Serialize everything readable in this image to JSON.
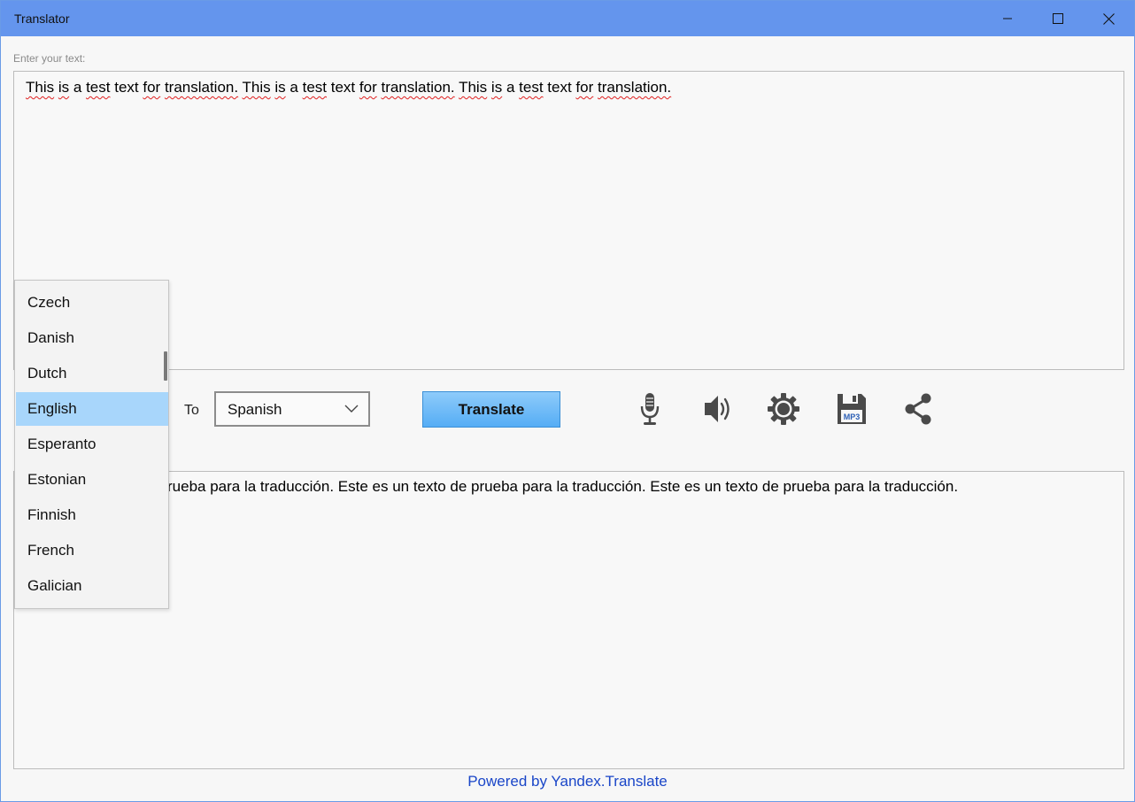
{
  "window": {
    "title": "Translator"
  },
  "input": {
    "label": "Enter your text:",
    "text_words": [
      "This",
      " ",
      "is",
      " ",
      "a",
      " ",
      "test",
      " ",
      "text",
      " ",
      "for",
      " ",
      "translation.",
      " ",
      "This",
      " ",
      "is",
      " ",
      "a",
      " ",
      "test",
      " ",
      "text",
      " ",
      "for",
      " ",
      "translation.",
      " ",
      "This",
      " ",
      "is",
      " ",
      "a",
      " ",
      "test",
      " ",
      "text",
      " ",
      "for",
      " ",
      "translation."
    ]
  },
  "controls": {
    "to_label": "To",
    "target_language": "Spanish",
    "translate_label": "Translate",
    "save_badge": "MP3"
  },
  "output": {
    "visible_text": "rueba para la traducción. Este es un texto de prueba para la traducción. Este es un texto de prueba para la traducción."
  },
  "dropdown": {
    "items": [
      "Czech",
      "Danish",
      "Dutch",
      "English",
      "Esperanto",
      "Estonian",
      "Finnish",
      "French",
      "Galician"
    ],
    "selected": "English",
    "selection_color": "#a8d6fb"
  },
  "footer": {
    "link": "Powered by Yandex.Translate"
  },
  "colors": {
    "titlebar": "#6495ed",
    "button": "#55adf5",
    "link": "#1a46c8",
    "spellcheck": "#e02020"
  },
  "icons": [
    "minimize-icon",
    "maximize-icon",
    "close-icon",
    "chevron-down-icon",
    "microphone-icon",
    "speaker-icon",
    "gear-icon",
    "floppy-disk-icon",
    "share-icon"
  ]
}
